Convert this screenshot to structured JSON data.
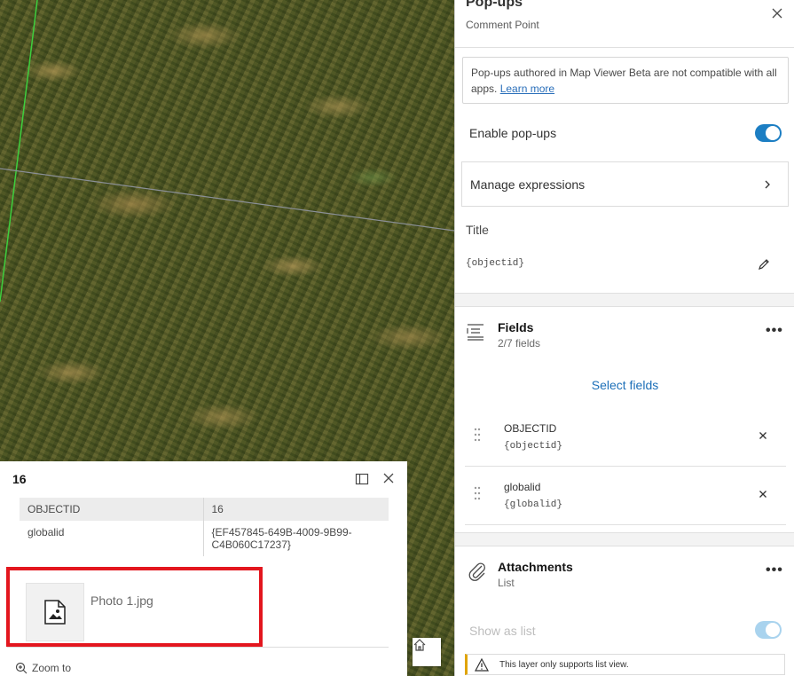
{
  "popup": {
    "title": "16",
    "rows": [
      {
        "field": "OBJECTID",
        "value": "16"
      },
      {
        "field": "globalid",
        "value": "{EF457845-649B-4009-9B99-C4B060C17237}"
      }
    ],
    "attachment_name": "Photo 1.jpg",
    "zoom_to_label": "Zoom to"
  },
  "panel": {
    "title": "Pop-ups",
    "subtitle": "Comment Point",
    "notice_text": "Pop-ups authored in Map Viewer Beta are not compatible with all apps.",
    "notice_link": "Learn more",
    "enable_label": "Enable pop-ups",
    "enable_on": true,
    "manage_label": "Manage expressions",
    "title_label": "Title",
    "title_value": "{objectid}",
    "fields_title": "Fields",
    "fields_count": "2/7 fields",
    "select_fields_label": "Select fields",
    "fields": [
      {
        "name": "OBJECTID",
        "expr": "{objectid}"
      },
      {
        "name": "globalid",
        "expr": "{globalid}"
      }
    ],
    "attachments_title": "Attachments",
    "attachments_sub": "List",
    "show_as_list_label": "Show as list",
    "warning_text": "This layer only supports list view."
  },
  "colors": {
    "accent": "#1c7ec3",
    "highlight": "#e3161e",
    "link": "#1c6fb8"
  }
}
